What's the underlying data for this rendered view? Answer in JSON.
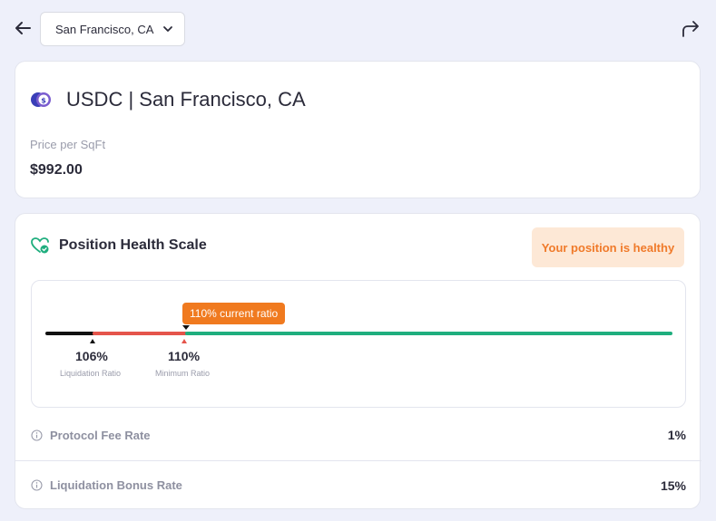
{
  "header": {
    "location": "San Francisco, CA"
  },
  "asset": {
    "title": "USDC | San Francisco, CA",
    "price_label": "Price per SqFt",
    "price_value": "$992.00"
  },
  "health": {
    "title": "Position Health Scale",
    "status_badge": "Your position is healthy",
    "current_ratio_label": "110% current ratio",
    "liquidation_ratio": "106%",
    "liquidation_caption": "Liquidation Ratio",
    "minimum_ratio": "110%",
    "minimum_caption": "Minimum Ratio"
  },
  "rates": [
    {
      "label": "Protocol Fee Rate",
      "value": "1%"
    },
    {
      "label": "Liquidation Bonus Rate",
      "value": "15%"
    }
  ],
  "colors": {
    "liquidation_segment": "#111111",
    "minimum_segment": "#e5544b",
    "healthy_segment": "#1fae7e",
    "accent_orange": "#f07a1f"
  },
  "icons": {
    "back": "arrow-left-icon",
    "share": "share-forward-icon",
    "dropdown": "chevron-down-icon",
    "asset": "usdc-logo",
    "health": "heart-icon",
    "info": "info-icon"
  }
}
